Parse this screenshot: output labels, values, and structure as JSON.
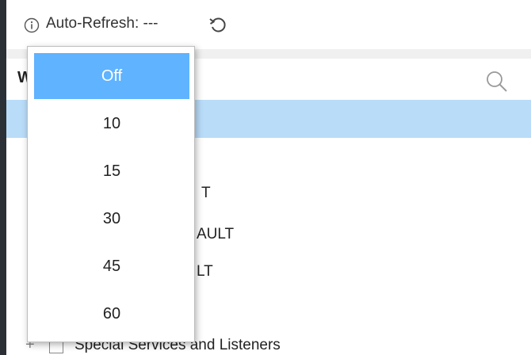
{
  "toolbar": {
    "info_icon": "info-circle-icon",
    "auto_refresh_label": "Auto-Refresh: ---",
    "refresh_icon": "refresh-icon"
  },
  "panel": {
    "header_letter": "W",
    "search_icon": "search-icon"
  },
  "tree": {
    "fragment_1": "T",
    "fragment_2": "AULT",
    "fragment_3": "LT",
    "bottom_item": {
      "expander": "+",
      "label": "Special Services and Listeners"
    }
  },
  "dropdown": {
    "selected": "Off",
    "options": [
      "Off",
      "10",
      "15",
      "30",
      "45",
      "60"
    ]
  },
  "colors": {
    "selected_option": "#5fb3ff",
    "selected_row": "#b9dcf8"
  }
}
